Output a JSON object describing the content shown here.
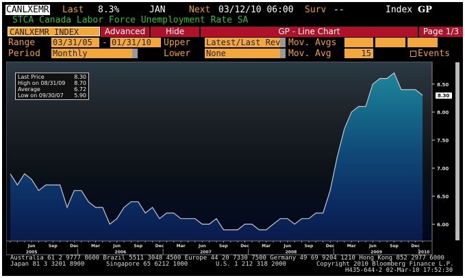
{
  "header": {
    "ticker": "CANLXEMR",
    "last_label": "Last",
    "last_value": "8.3%",
    "period": "JAN",
    "next_label": "Next",
    "next_value": "03/12/10 06:00",
    "surv_label": "Surv",
    "surv_value": "--",
    "index_label": "Index",
    "gp": "GP",
    "subtitle": "STCA Canada Labor Force Unemployment Rate SA"
  },
  "toolbar": {
    "security": "CANLXEMR INDEX",
    "advanced": "Advanced",
    "hide": "Hide",
    "chart_title": "GP - Line Chart",
    "page": "Page 1/3"
  },
  "controls": {
    "range_label": "Range",
    "range_start": "03/31/05",
    "dash": "-",
    "range_end": "01/31/10",
    "upper_label": "Upper",
    "upper_value": "Latest/Last Revi",
    "mov_avgs_label": "Mov. Avgs",
    "period_label": "Period",
    "period_value": "Monthly",
    "lower_label": "Lower",
    "lower_value": "None",
    "mov_avg_label": "Mov. Avg",
    "mov_avg_value": "15",
    "events_label": "Events"
  },
  "stats": {
    "rows": [
      {
        "label": "Last Price",
        "value": "8.30"
      },
      {
        "label": "High on 08/31/09",
        "value": "8.70"
      },
      {
        "label": "Average",
        "value": "6.72"
      },
      {
        "label": "Low on 09/30/07",
        "value": "5.90"
      }
    ]
  },
  "footer": {
    "line1": "Australia 61 2 9777 8600 Brazil 5511 3048 4500 Europe 44 20 7330 7500 Germany 49 69 9204 1210 Hong Kong 852 2977 6000",
    "line2a": "Japan 81 3 3201 8900",
    "line2b": "Singapore 65 6212 1000",
    "line2c": "U.S. 1 212 318 2000",
    "line2d": "Copyright 2010 Bloomberg Finance L.P.",
    "line3": "H435-644-2 02-Mar-10 17:52:30"
  },
  "colors": {
    "orange": "#f5a83a",
    "red": "#b01028",
    "green": "#2ec02e",
    "fill_top": "#1f8fa0",
    "fill_bottom": "#0a1a4a"
  },
  "chart_data": {
    "type": "area",
    "title": "CANLXEMR Index",
    "start": "Mar 2005",
    "frequency": "monthly",
    "values": [
      6.9,
      6.7,
      6.9,
      6.8,
      6.6,
      6.7,
      6.7,
      6.7,
      6.3,
      6.6,
      6.6,
      6.4,
      6.3,
      6.3,
      6.0,
      6.1,
      6.3,
      6.4,
      6.4,
      6.2,
      6.3,
      6.1,
      6.2,
      6.2,
      6.1,
      6.1,
      6.1,
      6.0,
      6.0,
      6.1,
      5.9,
      5.9,
      5.9,
      6.0,
      6.0,
      5.9,
      5.9,
      6.0,
      6.1,
      6.1,
      6.0,
      6.1,
      6.1,
      6.2,
      6.2,
      6.6,
      7.2,
      7.7,
      8.0,
      8.1,
      8.1,
      8.5,
      8.6,
      8.6,
      8.7,
      8.4,
      8.4,
      8.4,
      8.3
    ],
    "ylim": [
      5.7,
      8.9
    ],
    "y_ticks": [
      "6.00",
      "6.50",
      "7.00",
      "7.50",
      "8.00",
      "8.50"
    ],
    "last_label": "8.30",
    "x_month_ticks": [
      {
        "i": 3,
        "label": "Jun"
      },
      {
        "i": 6,
        "label": "Sep"
      },
      {
        "i": 9,
        "label": "Dec"
      },
      {
        "i": 12,
        "label": "Mar"
      },
      {
        "i": 15,
        "label": "Jun"
      },
      {
        "i": 18,
        "label": "Sep"
      },
      {
        "i": 21,
        "label": "Dec"
      },
      {
        "i": 24,
        "label": "Mar"
      },
      {
        "i": 27,
        "label": "Jun"
      },
      {
        "i": 30,
        "label": "Sep"
      },
      {
        "i": 33,
        "label": "Dec"
      },
      {
        "i": 36,
        "label": "Mar"
      },
      {
        "i": 39,
        "label": "Jun"
      },
      {
        "i": 42,
        "label": "Sep"
      },
      {
        "i": 45,
        "label": "Dec"
      },
      {
        "i": 48,
        "label": "Mar"
      },
      {
        "i": 51,
        "label": "Jun"
      },
      {
        "i": 54,
        "label": "Sep"
      },
      {
        "i": 57,
        "label": "Dec"
      }
    ],
    "x_year_ticks": [
      {
        "i": 3,
        "label": "2005"
      },
      {
        "i": 15.5,
        "label": "2006"
      },
      {
        "i": 27.5,
        "label": "2007"
      },
      {
        "i": 39.5,
        "label": "2008"
      },
      {
        "i": 51.5,
        "label": "2009"
      },
      {
        "i": 59.5,
        "label": "2010"
      }
    ]
  }
}
